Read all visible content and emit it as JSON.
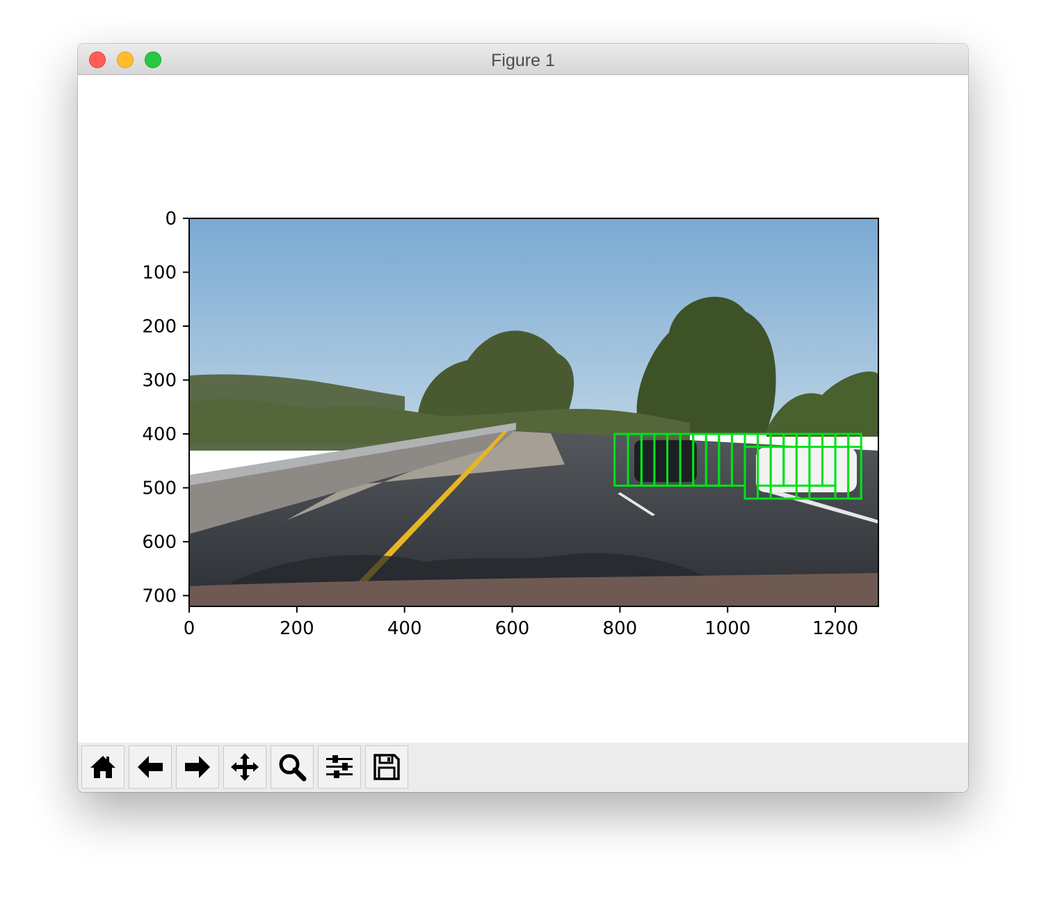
{
  "window": {
    "title": "Figure 1"
  },
  "toolbar": {
    "buttons": [
      {
        "name": "home",
        "icon": "home-icon"
      },
      {
        "name": "back",
        "icon": "arrow-left-icon"
      },
      {
        "name": "forward",
        "icon": "arrow-right-icon"
      },
      {
        "name": "pan",
        "icon": "move-icon"
      },
      {
        "name": "zoom",
        "icon": "magnifier-icon"
      },
      {
        "name": "configure-subplots",
        "icon": "sliders-icon"
      },
      {
        "name": "save",
        "icon": "floppy-disk-icon"
      }
    ]
  },
  "plot": {
    "image_description_colors": {
      "sky": "#8fb8d8",
      "road": "#3a3d44",
      "trees": "#3f4f2a",
      "lane_yellow": "#e8b624"
    },
    "box_color": "#00e11a"
  },
  "chart_data": {
    "type": "image",
    "title": "",
    "xlabel": "",
    "ylabel": "",
    "xlim": [
      0,
      1280
    ],
    "ylim": [
      720,
      0
    ],
    "xticks": [
      0,
      200,
      400,
      600,
      800,
      1000,
      1200
    ],
    "yticks": [
      0,
      100,
      200,
      300,
      400,
      500,
      600,
      700
    ],
    "boxes": [
      {
        "x1": 790,
        "y1": 400,
        "x2": 815,
        "y2": 496
      },
      {
        "x1": 815,
        "y1": 400,
        "x2": 840,
        "y2": 496
      },
      {
        "x1": 840,
        "y1": 400,
        "x2": 864,
        "y2": 496
      },
      {
        "x1": 864,
        "y1": 400,
        "x2": 888,
        "y2": 496
      },
      {
        "x1": 888,
        "y1": 400,
        "x2": 912,
        "y2": 496
      },
      {
        "x1": 912,
        "y1": 400,
        "x2": 936,
        "y2": 496
      },
      {
        "x1": 936,
        "y1": 400,
        "x2": 960,
        "y2": 496
      },
      {
        "x1": 960,
        "y1": 400,
        "x2": 984,
        "y2": 496
      },
      {
        "x1": 984,
        "y1": 400,
        "x2": 1008,
        "y2": 496
      },
      {
        "x1": 1008,
        "y1": 400,
        "x2": 1032,
        "y2": 496
      },
      {
        "x1": 840,
        "y1": 400,
        "x2": 984,
        "y2": 496
      },
      {
        "x1": 1032,
        "y1": 400,
        "x2": 1056,
        "y2": 520
      },
      {
        "x1": 1056,
        "y1": 400,
        "x2": 1080,
        "y2": 520
      },
      {
        "x1": 1080,
        "y1": 400,
        "x2": 1104,
        "y2": 496
      },
      {
        "x1": 1104,
        "y1": 400,
        "x2": 1128,
        "y2": 496
      },
      {
        "x1": 1128,
        "y1": 400,
        "x2": 1152,
        "y2": 520
      },
      {
        "x1": 1152,
        "y1": 400,
        "x2": 1176,
        "y2": 496
      },
      {
        "x1": 1176,
        "y1": 400,
        "x2": 1200,
        "y2": 496
      },
      {
        "x1": 1200,
        "y1": 400,
        "x2": 1224,
        "y2": 520
      },
      {
        "x1": 1224,
        "y1": 400,
        "x2": 1248,
        "y2": 520
      },
      {
        "x1": 1032,
        "y1": 424,
        "x2": 1248,
        "y2": 520
      },
      {
        "x1": 1056,
        "y1": 400,
        "x2": 1200,
        "y2": 496
      }
    ]
  }
}
